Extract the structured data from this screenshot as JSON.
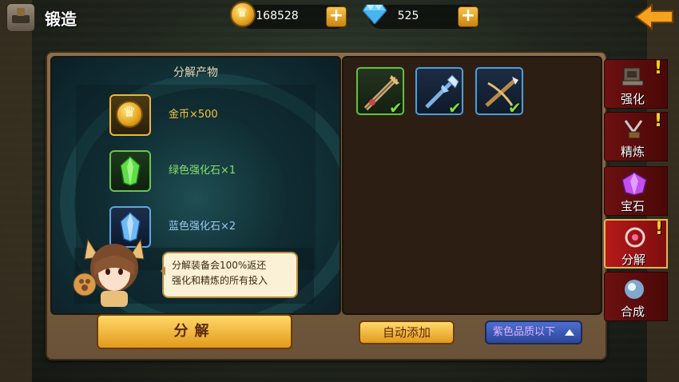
{
  "header": {
    "title": "锻造",
    "gold": "168528",
    "diamonds": "525",
    "plus_symbol": "+"
  },
  "products": {
    "title": "分解产物",
    "items": [
      {
        "icon": "gold-coin-icon",
        "label": "金币×500",
        "color": "#f5c542"
      },
      {
        "icon": "green-stone-icon",
        "label": "绿色强化石×1",
        "color": "#8be06a"
      },
      {
        "icon": "blue-stone-icon",
        "label": "蓝色强化石×2",
        "color": "#9cc9f0"
      }
    ]
  },
  "tip": {
    "line1": "分解装备会100%返还",
    "line2": "强化和精炼的所有投入"
  },
  "equipment": [
    {
      "icon": "green-sword-icon",
      "quality": "green",
      "checked": "✔"
    },
    {
      "icon": "blue-spear-icon",
      "quality": "blue",
      "checked": "✔"
    },
    {
      "icon": "blue-crossbow-icon",
      "quality": "blue",
      "checked": "✔"
    }
  ],
  "buttons": {
    "decompose": "分解",
    "auto_add": "自动添加",
    "quality_filter": "紫色品质以下"
  },
  "tabs": [
    {
      "label": "强化",
      "alert": "!",
      "active": false
    },
    {
      "label": "精炼",
      "alert": "!",
      "active": false
    },
    {
      "label": "宝石",
      "alert": "",
      "active": false
    },
    {
      "label": "分解",
      "alert": "!",
      "active": true
    },
    {
      "label": "合成",
      "alert": "",
      "active": false
    }
  ],
  "colors": {
    "accent_gold": "#e29a1c",
    "tab_red": "#7e0d0d",
    "quality_purple": "#e0b3ff"
  }
}
